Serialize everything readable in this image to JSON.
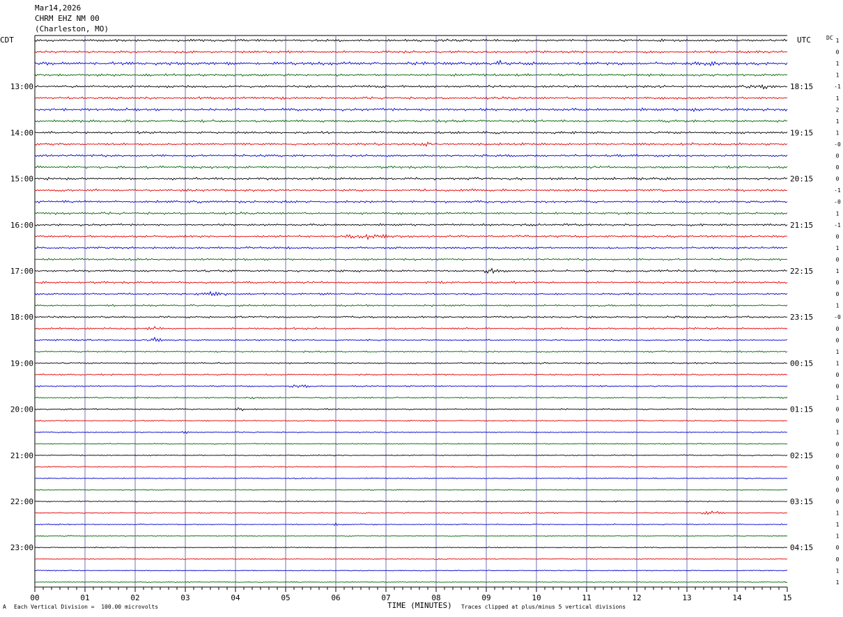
{
  "header": {
    "date": "Mar14,2026",
    "station": "CHRM EHZ NM 00",
    "location": "(Charleston, MO)"
  },
  "left_axis_title": "CDT",
  "right_axis_title": "UTC",
  "dc_title": "DC",
  "footer": {
    "scale_note": "Each Vertical Division =  100.00 microvolts",
    "x_axis_title": "TIME (MINUTES)",
    "clip_note": "Traces clipped at plus/minus 5 vertical divisions",
    "corner_mark": "A"
  },
  "colors": {
    "trace_cycle": [
      "#000000",
      "#e00000",
      "#0000d0",
      "#006400"
    ],
    "grid": "#7070b0"
  },
  "chart_data": {
    "type": "line",
    "title": "Mar14,2026 CHRM EHZ NM 00 (Charleston, MO)",
    "xlabel": "TIME (MINUTES)",
    "ylabel_left": "CDT",
    "ylabel_right": "UTC",
    "xlim": [
      0,
      15
    ],
    "x_ticks": [
      "00",
      "01",
      "02",
      "03",
      "04",
      "05",
      "06",
      "07",
      "08",
      "09",
      "10",
      "11",
      "12",
      "13",
      "14",
      "15"
    ],
    "traces_per_hour": 4,
    "trace_count": 48,
    "cdt_labels": [
      "13:00",
      "14:00",
      "15:00",
      "16:00",
      "17:00",
      "18:00",
      "19:00",
      "20:00",
      "21:00",
      "22:00",
      "23:00"
    ],
    "utc_labels": [
      "18:15",
      "19:15",
      "20:15",
      "21:15",
      "22:15",
      "23:15",
      "00:15",
      "01:15",
      "02:15",
      "03:15",
      "04:15"
    ],
    "hour_label_first_trace": 4,
    "dc_offsets": [
      "1",
      "0",
      "1",
      "1",
      "-1",
      "1",
      "2",
      "1",
      "1",
      "-0",
      "0",
      "0",
      "0",
      "-1",
      "-0",
      "1",
      "-1",
      "0",
      "1",
      "0",
      "1",
      "0",
      "0",
      "1",
      "-0",
      "0",
      "0",
      "1",
      "1",
      "0",
      "0",
      "1",
      "0",
      "0",
      "1",
      "0",
      "0",
      "0",
      "0",
      "0",
      "0",
      "1",
      "1",
      "1",
      "0",
      "0",
      "1",
      "1"
    ],
    "amplitude": [
      2,
      2,
      2.5,
      2,
      2,
      2,
      2.3,
      2,
      2,
      2,
      2,
      2,
      2,
      2,
      2,
      2,
      1.8,
      1.8,
      1.8,
      1.7,
      1.8,
      1.8,
      1.6,
      1.6,
      1.7,
      1.6,
      1.3,
      1.3,
      1.4,
      1.3,
      1.2,
      1.2,
      1.2,
      1.1,
      1.0,
      1.0,
      1.0,
      1.0,
      0.9,
      0.9,
      0.9,
      1.0,
      0.9,
      0.9,
      0.9,
      0.9,
      0.8,
      0.8
    ],
    "events": [
      {
        "trace": 2,
        "minute": 9.3,
        "width": 0.5,
        "amp": 4
      },
      {
        "trace": 2,
        "minute": 13.5,
        "width": 0.8,
        "amp": 3
      },
      {
        "trace": 4,
        "minute": 14.5,
        "width": 0.7,
        "amp": 4
      },
      {
        "trace": 6,
        "minute": 13.2,
        "width": 0.3,
        "amp": 4
      },
      {
        "trace": 9,
        "minute": 7.8,
        "width": 0.3,
        "amp": 3
      },
      {
        "trace": 17,
        "minute": 6.6,
        "width": 1.2,
        "amp": 5
      },
      {
        "trace": 20,
        "minute": 9.1,
        "width": 0.4,
        "amp": 4
      },
      {
        "trace": 22,
        "minute": 3.5,
        "width": 1.0,
        "amp": 3
      },
      {
        "trace": 25,
        "minute": 2.4,
        "width": 0.5,
        "amp": 3
      },
      {
        "trace": 26,
        "minute": 2.4,
        "width": 0.4,
        "amp": 3
      },
      {
        "trace": 30,
        "minute": 5.3,
        "width": 0.5,
        "amp": 3
      },
      {
        "trace": 31,
        "minute": 4.4,
        "width": 0.5,
        "amp": 2
      },
      {
        "trace": 32,
        "minute": 4.1,
        "width": 0.3,
        "amp": 3
      },
      {
        "trace": 34,
        "minute": 3.0,
        "width": 0.3,
        "amp": 2
      },
      {
        "trace": 41,
        "minute": 13.5,
        "width": 0.6,
        "amp": 3
      },
      {
        "trace": 42,
        "minute": 6.0,
        "width": 0.1,
        "amp": 3
      }
    ]
  }
}
